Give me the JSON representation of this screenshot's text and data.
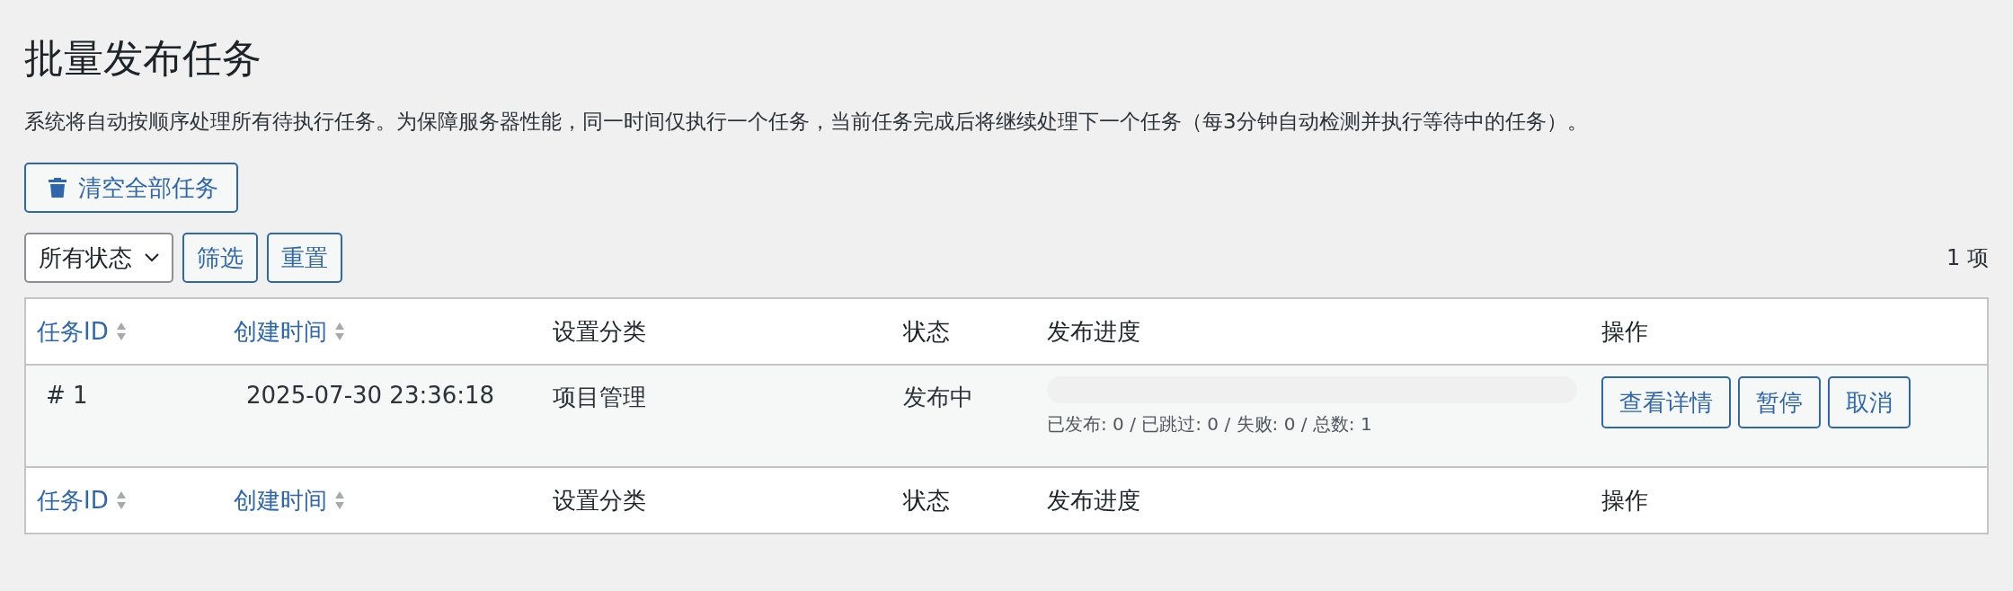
{
  "page_title": "批量发布任务",
  "description": "系统将自动按顺序处理所有待执行任务。为保障服务器性能，同一时间仅执行一个任务，当前任务完成后将继续处理下一个任务（每3分钟自动检测并执行等待中的任务）。",
  "clear_button": "清空全部任务",
  "filter": {
    "status_select": "所有状态",
    "filter_button": "筛选",
    "reset_button": "重置",
    "count": "1 项"
  },
  "table": {
    "columns": [
      {
        "label": "任务ID",
        "sortable": true
      },
      {
        "label": "创建时间",
        "sortable": true
      },
      {
        "label": "设置分类",
        "sortable": false
      },
      {
        "label": "状态",
        "sortable": false
      },
      {
        "label": "发布进度",
        "sortable": false
      },
      {
        "label": "操作",
        "sortable": false
      }
    ],
    "rows": [
      {
        "id": "# 1",
        "created": "2025-07-30 23:36:18",
        "category": "项目管理",
        "status": "发布中",
        "progress": {
          "level": 0,
          "summary": "已发布: 0 / 已跳过: 0 / 失败: 0 / 总数: 1"
        },
        "actions": [
          "查看详情",
          "暂停",
          "取消"
        ]
      }
    ],
    "footer_columns": [
      {
        "label": "任务ID",
        "sortable": true
      },
      {
        "label": "创建时间",
        "sortable": true
      },
      {
        "label": "设置分类",
        "sortable": false
      },
      {
        "label": "状态",
        "sortable": false
      },
      {
        "label": "发布进度",
        "sortable": false
      },
      {
        "label": "操作",
        "sortable": false
      }
    ]
  }
}
